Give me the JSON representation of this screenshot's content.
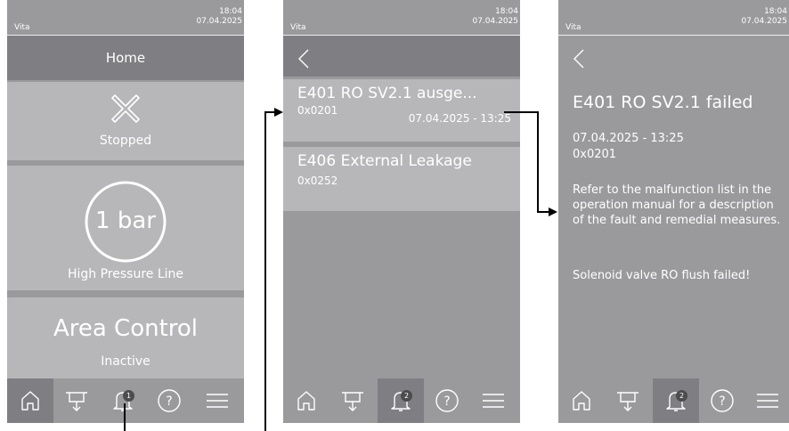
{
  "status": {
    "brand": "Vita",
    "time": "18:04",
    "date": "07.04.2025"
  },
  "screen1": {
    "header_title": "Home",
    "tiles": {
      "status_label": "Stopped",
      "pressure_value": "1 bar",
      "pressure_label": "High Pressure Line",
      "area_title": "Area Control",
      "area_status": "Inactive"
    },
    "badge_count": "1"
  },
  "screen2": {
    "messages": [
      {
        "title": "E401 RO SV2.1 ausge...",
        "hex": "0x0201",
        "timestamp": "07.04.2025 - 13:25"
      },
      {
        "title": "E406 External Leakage",
        "hex": "0x0252"
      }
    ],
    "badge_count": "2"
  },
  "screen3": {
    "title": "E401  RO SV2.1 failed",
    "timestamp": "07.04.2025 - 13:25",
    "hex": "0x0201",
    "description": "Refer to the malfunction list in the operation manual for a description of the fault and remedial measures.",
    "detail": "Solenoid valve RO flush failed!",
    "badge_count": "2"
  },
  "nav": [
    "home-icon",
    "water-outlet-icon",
    "bell-icon",
    "help-icon",
    "menu-icon"
  ],
  "colors": {
    "panel": "#9a9a9d",
    "header": "#7f7f83",
    "tile": "#b7b7ba",
    "text": "#ffffff"
  }
}
